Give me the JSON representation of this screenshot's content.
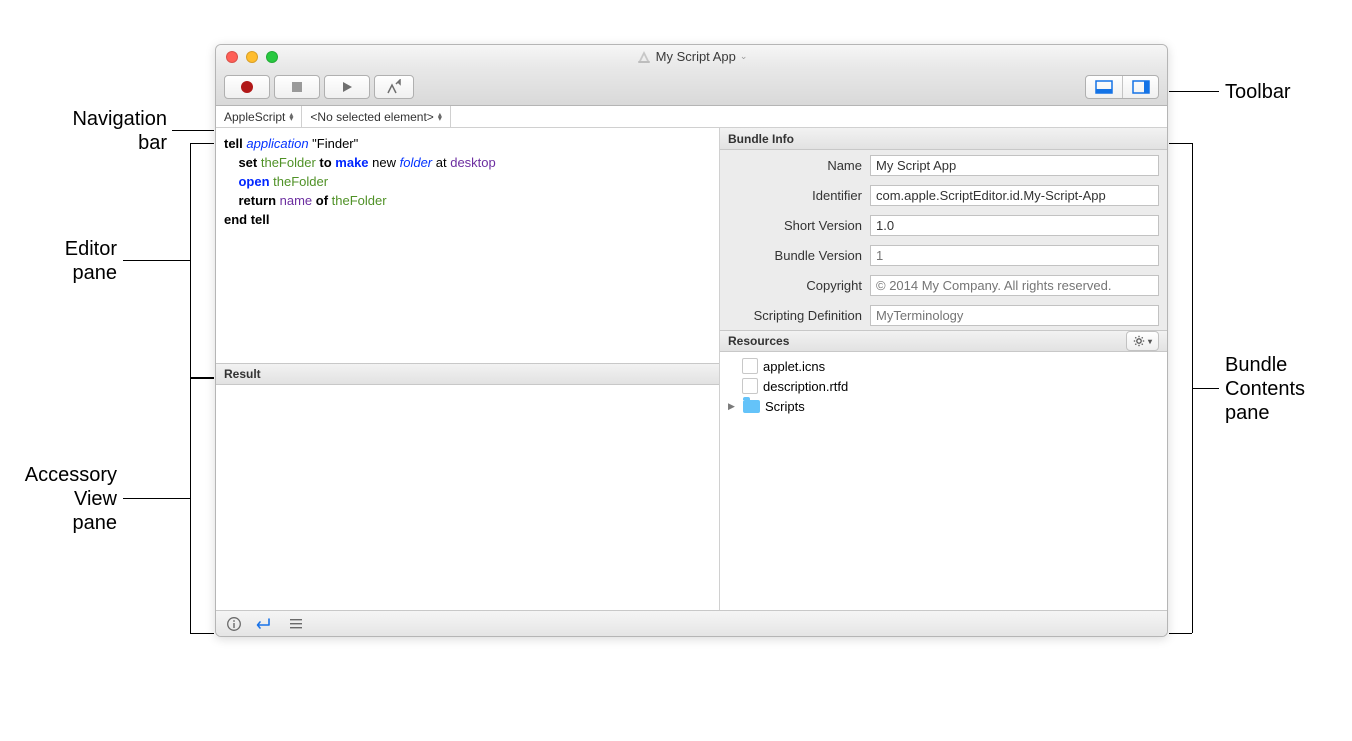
{
  "callouts": {
    "navigation": "Navigation\nbar",
    "editor": "Editor\npane",
    "accessory": "Accessory\nView\npane",
    "toolbar": "Toolbar",
    "bundle": "Bundle\nContents\npane"
  },
  "window": {
    "title": "My Script App"
  },
  "navbar": {
    "language": "AppleScript",
    "element": "<No selected element>"
  },
  "code": {
    "l1_a": "tell ",
    "l1_b": "application",
    "l1_c": " \"Finder\"",
    "l2_a": "set ",
    "l2_b": "theFolder",
    "l2_c": " to ",
    "l2_d": "make",
    "l2_e": " new ",
    "l2_f": "folder",
    "l2_g": " at ",
    "l2_h": "desktop",
    "l3_a": "open ",
    "l3_b": "theFolder",
    "l4_a": "return ",
    "l4_b": "name",
    "l4_c": " of ",
    "l4_d": "theFolder",
    "l5": "end tell"
  },
  "result": {
    "header": "Result"
  },
  "bundle_info": {
    "header": "Bundle Info",
    "rows": {
      "name_label": "Name",
      "name_value": "My Script App",
      "identifier_label": "Identifier",
      "identifier_value": "com.apple.ScriptEditor.id.My-Script-App",
      "short_label": "Short Version",
      "short_value": "1.0",
      "bundle_label": "Bundle Version",
      "bundle_placeholder": "1",
      "copyright_label": "Copyright",
      "copyright_placeholder": "© 2014 My Company. All rights reserved.",
      "scripting_label": "Scripting Definition",
      "scripting_placeholder": "MyTerminology"
    }
  },
  "resources": {
    "header": "Resources",
    "items": [
      {
        "name": "applet.icns",
        "kind": "file"
      },
      {
        "name": "description.rtfd",
        "kind": "file"
      },
      {
        "name": "Scripts",
        "kind": "folder"
      }
    ]
  }
}
